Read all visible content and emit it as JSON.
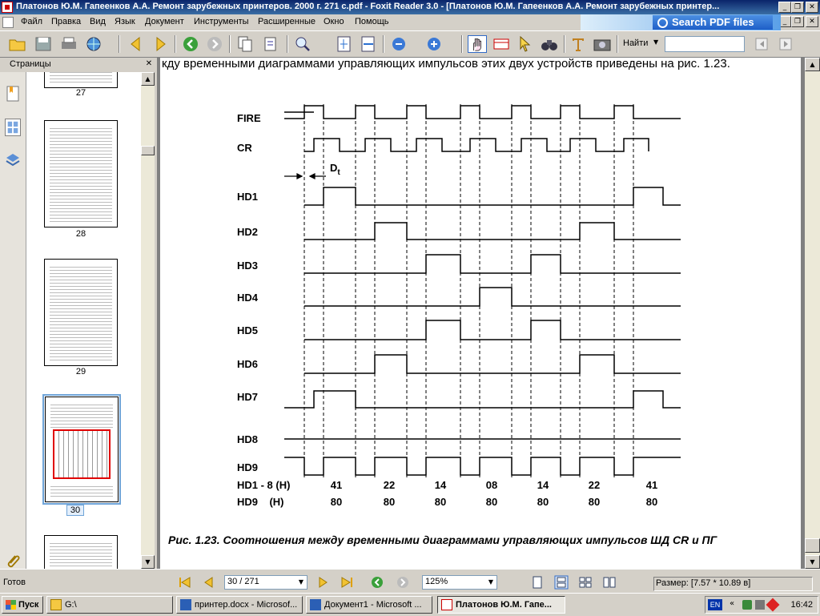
{
  "window": {
    "title": "Платонов Ю.М. Гапеенков А.А. Ремонт зарубежных принтеров. 2000 г. 271 с.pdf - Foxit Reader 3.0 - [Платонов Ю.М. Гапеенков А.А. Ремонт зарубежных принтер..."
  },
  "menu": {
    "items": [
      "Файл",
      "Правка",
      "Вид",
      "Язык",
      "Документ",
      "Инструменты",
      "Расширенные",
      "Окно",
      "Помощь"
    ],
    "ad": "Search PDF files"
  },
  "toolbar": {
    "find_label": "Найти",
    "find_value": ""
  },
  "sidebar": {
    "title": "Страницы",
    "pages": [
      "27",
      "28",
      "29",
      "30"
    ]
  },
  "document": {
    "top_text": "кду временными диаграммами управляющих импульсов этих двух устройств приведены на рис. 1.23.",
    "caption": "Рис. 1.23. Соотношения между временными диаграммами управляющих импульсов ШД CR и ПГ",
    "signals": [
      "FIRE",
      "CR",
      "HD1",
      "HD2",
      "HD3",
      "HD4",
      "HD5",
      "HD6",
      "HD7",
      "HD8",
      "HD9"
    ],
    "dt_label": "D",
    "dt_sub": "t",
    "hd18_label": "HD1 - 8 (H)",
    "hd18_values": [
      "41",
      "22",
      "14",
      "08",
      "14",
      "22",
      "41"
    ],
    "hd9_label": "HD9    (H)",
    "hd9_values": [
      "80",
      "80",
      "80",
      "80",
      "80",
      "80",
      "80"
    ]
  },
  "status": {
    "ready": "Готов",
    "page": "30 / 271",
    "zoom": "125%",
    "size": "Размер: [7.57 * 10.89 в]"
  },
  "taskbar": {
    "start": "Пуск",
    "tasks": [
      "G:\\",
      "принтер.docx - Microsof...",
      "Документ1 - Microsoft ...",
      "Платонов Ю.М. Гапе..."
    ],
    "lang": "EN",
    "time": "16:42"
  }
}
